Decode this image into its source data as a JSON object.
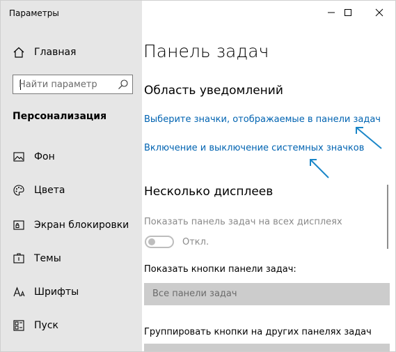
{
  "window": {
    "title": "Параметры"
  },
  "sidebar": {
    "home_label": "Главная",
    "search_placeholder": "Найти параметр",
    "section_title": "Персонализация",
    "items": [
      {
        "label": "Фон",
        "icon": "image-icon"
      },
      {
        "label": "Цвета",
        "icon": "palette-icon"
      },
      {
        "label": "Экран блокировки",
        "icon": "lock-screen-icon"
      },
      {
        "label": "Темы",
        "icon": "brush-icon"
      },
      {
        "label": "Шрифты",
        "icon": "font-icon"
      },
      {
        "label": "Пуск",
        "icon": "start-icon"
      }
    ]
  },
  "main": {
    "title": "Панель задач",
    "notifications": {
      "heading": "Область уведомлений",
      "link1": "Выберите значки, отображаемые в панели задач",
      "link2": "Включение и выключение системных значков"
    },
    "multiple_displays": {
      "heading": "Несколько дисплеев",
      "show_taskbar_label": "Показать панель задач на всех дисплеях",
      "toggle_state": "Откл.",
      "show_buttons_label": "Показать кнопки панели задач:",
      "show_buttons_value": "Все панели задач",
      "group_label": "Группировать кнопки на других панелях задач"
    }
  },
  "colors": {
    "sidebar_bg": "#e6e6e6",
    "link": "#0063b1",
    "annotation_arrow": "#1a86c8"
  }
}
